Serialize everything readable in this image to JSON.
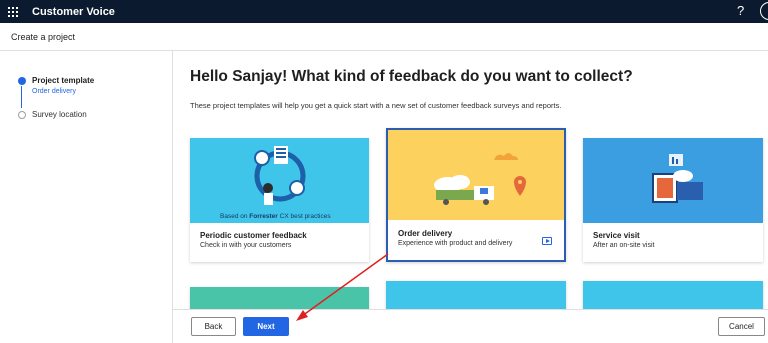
{
  "app": {
    "name": "Customer Voice",
    "help": "?"
  },
  "subheader": {
    "title": "Create a project"
  },
  "steps": [
    {
      "title": "Project template",
      "subtitle": "Order delivery",
      "state": "active"
    },
    {
      "title": "Survey location",
      "subtitle": "",
      "state": "inactive"
    }
  ],
  "main": {
    "heading": "Hello Sanjay! What kind of feedback do you want to collect?",
    "description": "These project templates will help you get a quick start with a new set of customer feedback surveys and reports."
  },
  "cards": [
    {
      "title": "Periodic customer feedback",
      "subtitle": "Check in with your customers",
      "badge_prefix": "Based on",
      "badge_bold": "Forrester",
      "badge_suffix": "CX best practices",
      "color": "#3fc4ea",
      "selected": false
    },
    {
      "title": "Order delivery",
      "subtitle": "Experience with product and delivery",
      "color": "#fdd15d",
      "selected": true
    },
    {
      "title": "Service visit",
      "subtitle": "After an on-site visit",
      "color": "#3b9ee0",
      "selected": false
    }
  ],
  "footer": {
    "back": "Back",
    "next": "Next",
    "cancel": "Cancel"
  },
  "colors": {
    "topbar": "#0b1a2e",
    "accent": "#2266e3",
    "annotation_arrow": "#e02020"
  }
}
